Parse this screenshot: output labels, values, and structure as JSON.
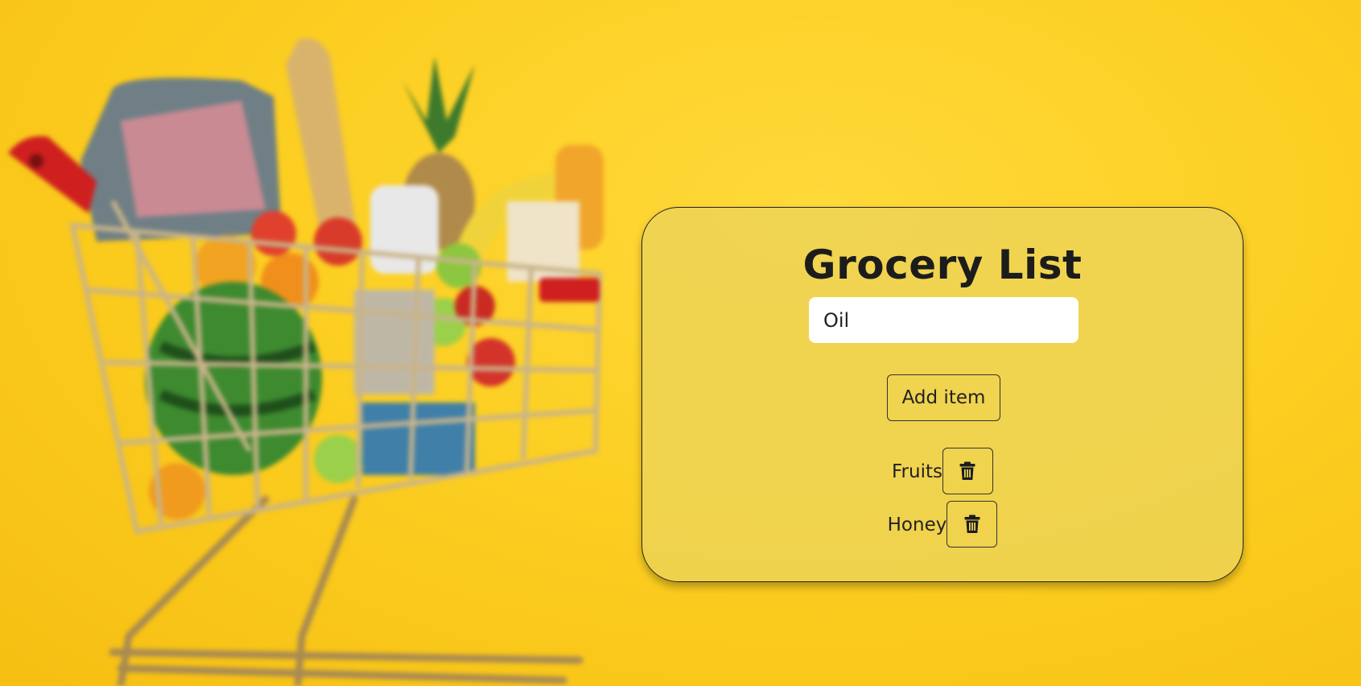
{
  "app": {
    "title": "Grocery List"
  },
  "input": {
    "value": "Oil",
    "placeholder": ""
  },
  "add_button": {
    "label": "Add item"
  },
  "items": [
    {
      "name": "Fruits",
      "delete_icon": "trash-icon"
    },
    {
      "name": "Honey",
      "delete_icon": "trash-icon"
    }
  ],
  "colors": {
    "background": "#fccf22",
    "card": "#ecd35a",
    "text": "#1c1c1c",
    "input_bg": "#ffffff"
  },
  "background_image": {
    "icon": "shopping-cart-icon"
  }
}
